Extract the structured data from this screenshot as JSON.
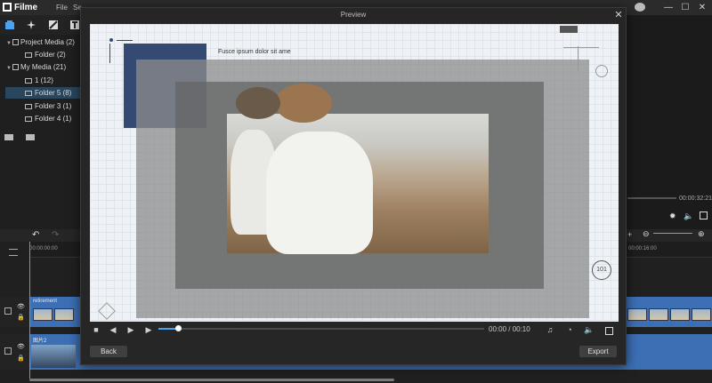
{
  "app": {
    "name": "Filme",
    "menu": [
      "File",
      "Se"
    ],
    "window_controls": [
      "—",
      "☐",
      "✕"
    ]
  },
  "media_tree": [
    {
      "label": "Project Media (2)",
      "expanded": true,
      "level": 0
    },
    {
      "label": "Folder (2)",
      "level": 1
    },
    {
      "label": "My Media (21)",
      "expanded": true,
      "level": 0
    },
    {
      "label": "1 (12)",
      "level": 1
    },
    {
      "label": "Folder 5 (8)",
      "level": 1,
      "selected": true
    },
    {
      "label": "Folder 3 (1)",
      "level": 1
    },
    {
      "label": "Folder 4 (1)",
      "level": 1
    }
  ],
  "right_panel": {
    "time": "00:00:32:21"
  },
  "timeline": {
    "ruler_start": "00:00:00:00",
    "ruler_mark": "00:00:16:00",
    "track1_clip": "retirement",
    "track2_clip": "图片2"
  },
  "preview": {
    "title": "Preview",
    "stage_text": "Fusce ipsum dolor sit ame",
    "badge": "101",
    "time": "00:00 / 00:10",
    "progress": 0.06,
    "back_label": "Back",
    "export_label": "Export"
  },
  "colors": {
    "accent": "#4aa3f0",
    "selection": "#29465d",
    "track": "#3c6fb4",
    "navy": "#344a73"
  }
}
